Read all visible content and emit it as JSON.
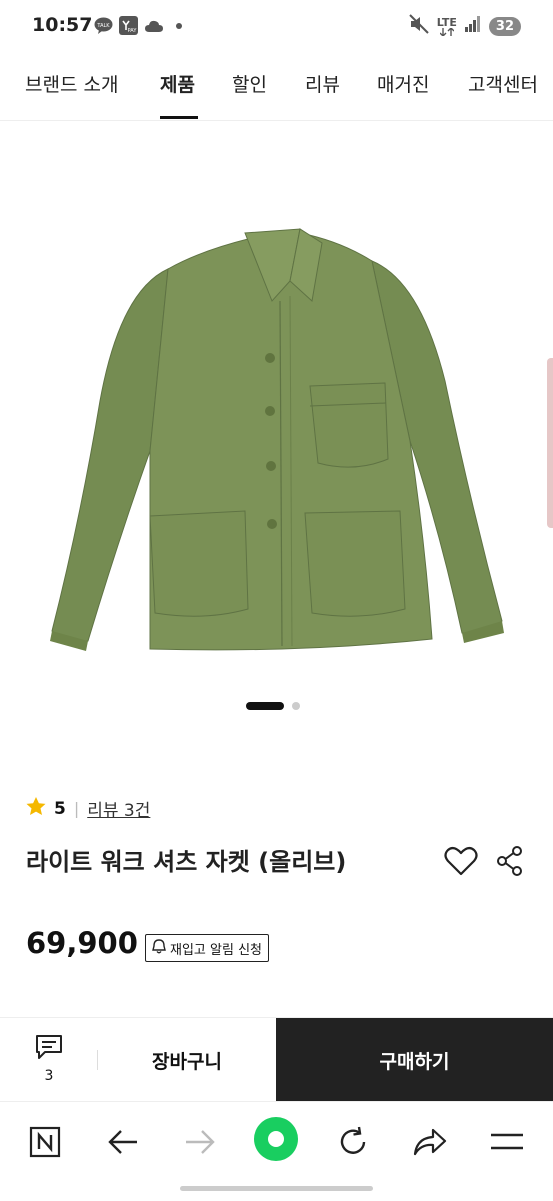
{
  "status_bar": {
    "time": "10:57",
    "left_icons": [
      "talk-icon",
      "pay-icon",
      "cloud-icon",
      "dot-icon"
    ],
    "right_icons": [
      "mute-icon",
      "lte-icon",
      "signal-icon"
    ],
    "network": "LTE",
    "battery": "32"
  },
  "nav": {
    "tabs": [
      {
        "label": "브랜드 소개",
        "active": false
      },
      {
        "label": "제품",
        "active": true
      },
      {
        "label": "할인",
        "active": false
      },
      {
        "label": "리뷰",
        "active": false
      },
      {
        "label": "매거진",
        "active": false
      },
      {
        "label": "고객센터",
        "active": false
      }
    ]
  },
  "product": {
    "image_name": "olive-work-shirt-jacket",
    "rating": "5",
    "review_link": "리뷰 3건",
    "title": "라이트 워크 셔츠 자켓 (올리브)",
    "price": "69,900",
    "restock_label": "재입고 알림 신청",
    "carousel": {
      "total": 2,
      "current": 1
    }
  },
  "bottom_bar": {
    "review_count": "3",
    "cart_label": "장바구니",
    "buy_label": "구매하기"
  },
  "browser_bar": {
    "icons": [
      "naver-n-icon",
      "back-arrow-icon",
      "forward-arrow-icon",
      "green-home-icon",
      "refresh-icon",
      "share-arrow-icon",
      "menu-icon"
    ]
  },
  "colors": {
    "buy_bg": "#222222",
    "jacket": "#7d9358",
    "star": "#f5b800",
    "green_button": "#19ce60"
  }
}
